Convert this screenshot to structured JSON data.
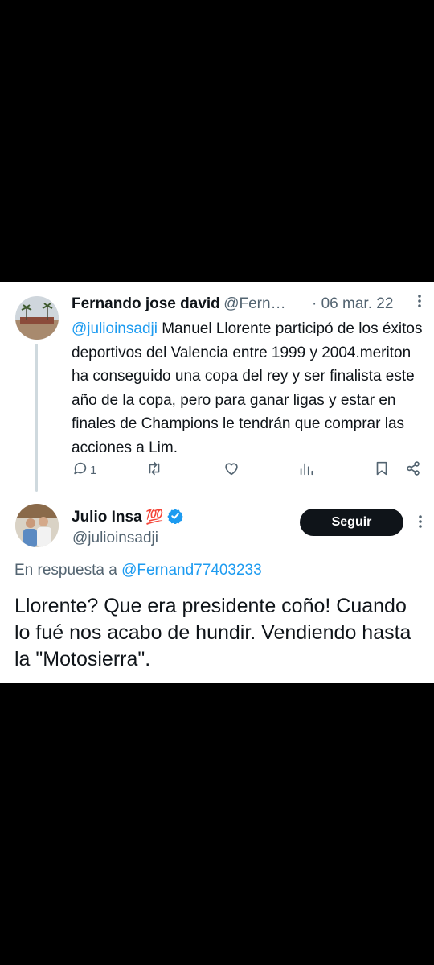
{
  "tweet1": {
    "author_name": "Fernando jose david",
    "handle": "@Fern…",
    "date": "· 06 mar. 22",
    "mention": "@julioinsadji",
    "text": " Manuel Llorente participó de los éxitos deportivos del Valencia entre 1999 y 2004.meriton ha conseguido una copa del rey y ser finalista este año de la copa, pero para ganar ligas y estar en finales de Champions le tendrán que comprar las acciones a Lim.",
    "reply_count": "1",
    "icons": [
      "reply-icon",
      "retweet-icon",
      "like-icon",
      "views-icon",
      "bookmark-icon",
      "share-icon",
      "more-icon"
    ]
  },
  "tweet2": {
    "author_name": "Julio Insa",
    "emoji": "💯",
    "handle": "@julioinsadji",
    "follow_label": "Seguir",
    "reply_prefix": "En respuesta a ",
    "reply_mention": "@Fernand77403233",
    "text": "Llorente? Que era presidente coño! Cuando lo fué nos acabo de hundir. Vendiendo hasta la \"Motosierra\".",
    "verified_color": "#1d9bf0"
  },
  "colors": {
    "accent": "#1d9bf0",
    "secondary_text": "#536471",
    "button_bg": "#0f1419",
    "backdrop": "#000000"
  }
}
